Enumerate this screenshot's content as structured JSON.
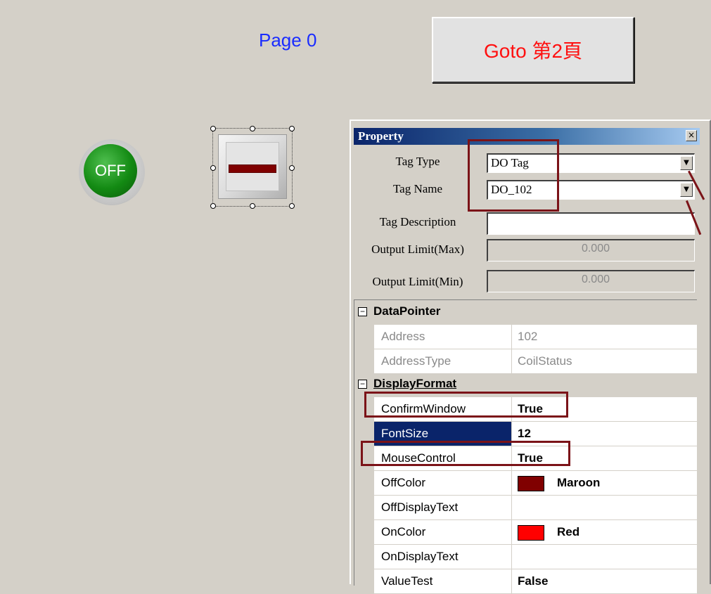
{
  "canvas": {
    "page_label": "Page 0",
    "goto_button_label": "Goto 第2頁",
    "lamp_text": "OFF"
  },
  "property_panel": {
    "title": "Property",
    "close_glyph": "×",
    "fields": {
      "tag_type": {
        "label": "Tag Type",
        "value": "DO Tag"
      },
      "tag_name": {
        "label": "Tag Name",
        "value": "DO_102"
      },
      "tag_description": {
        "label": "Tag Description",
        "value": ""
      },
      "output_max": {
        "label": "Output Limit(Max)",
        "value": "0.000"
      },
      "output_min": {
        "label": "Output Limit(Min)",
        "value": "0.000"
      }
    },
    "grid": {
      "data_pointer": {
        "label": "DataPointer",
        "toggle": "−",
        "rows": [
          {
            "name": "Address",
            "value": "102"
          },
          {
            "name": "AddressType",
            "value": "CoilStatus"
          }
        ]
      },
      "display_format": {
        "label": "DisplayFormat",
        "toggle": "−",
        "rows": [
          {
            "name": "ConfirmWindow",
            "value": "True"
          },
          {
            "name": "FontSize",
            "value": "12"
          },
          {
            "name": "MouseControl",
            "value": "True"
          },
          {
            "name": "OffColor",
            "value": "Maroon",
            "swatch": "#800000"
          },
          {
            "name": "OffDisplayText",
            "value": ""
          },
          {
            "name": "OnColor",
            "value": "Red",
            "swatch": "#ff0000"
          },
          {
            "name": "OnDisplayText",
            "value": ""
          },
          {
            "name": "ValueTest",
            "value": "False"
          }
        ]
      }
    }
  },
  "annotation_color": "#7b1318"
}
